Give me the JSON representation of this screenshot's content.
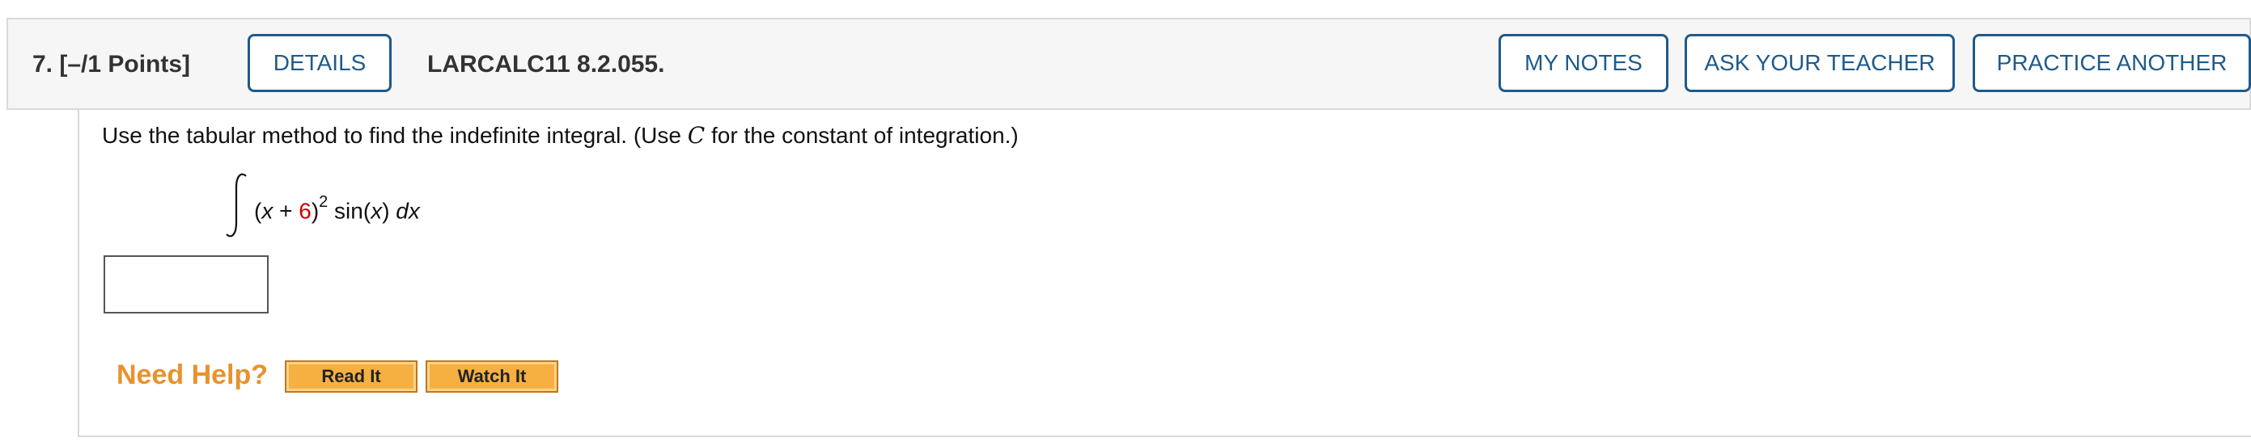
{
  "question": {
    "number_points": "7.  [–/1 Points]",
    "details_label": "DETAILS",
    "code": "LARCALC11 8.2.055.",
    "my_notes_label": "MY NOTES",
    "ask_teacher_label": "ASK YOUR TEACHER",
    "practice_label": "PRACTICE ANOTHER"
  },
  "problem": {
    "instruction_pre": "Use the tabular method to find the indefinite integral. (Use ",
    "instruction_var": "C",
    "instruction_post": " for the constant of integration.)",
    "integrand": {
      "open": "(",
      "x": "x",
      "plus": " + ",
      "constant": "6",
      "close": ")",
      "exponent": "2",
      "func": " sin(",
      "func_x": "x",
      "func_close": ") ",
      "dx": "dx"
    },
    "constant_color": "#cc0000",
    "answer_value": ""
  },
  "help": {
    "label": "Need Help?",
    "read_label": "Read It",
    "watch_label": "Watch It",
    "label_color": "#e8922e",
    "button_color": "#f5b041"
  },
  "colors": {
    "accent": "#1f5a8a",
    "header_bg": "#f6f6f6",
    "border": "#d9d9d9"
  }
}
